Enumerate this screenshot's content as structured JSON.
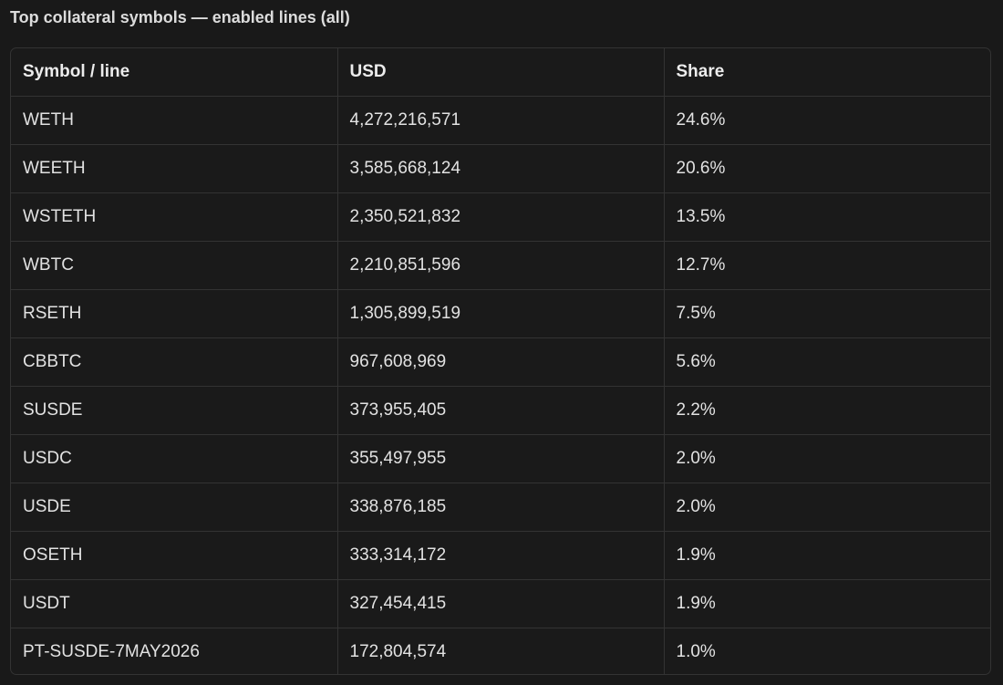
{
  "heading": "Top collateral symbols — enabled lines (all)",
  "table": {
    "columns": [
      "Symbol / line",
      "USD",
      "Share"
    ],
    "rows": [
      [
        "WETH",
        "4,272,216,571",
        "24.6%"
      ],
      [
        "WEETH",
        "3,585,668,124",
        "20.6%"
      ],
      [
        "WSTETH",
        "2,350,521,832",
        "13.5%"
      ],
      [
        "WBTC",
        "2,210,851,596",
        "12.7%"
      ],
      [
        "RSETH",
        "1,305,899,519",
        "7.5%"
      ],
      [
        "CBBTC",
        "967,608,969",
        "5.6%"
      ],
      [
        "SUSDE",
        "373,955,405",
        "2.2%"
      ],
      [
        "USDC",
        "355,497,955",
        "2.0%"
      ],
      [
        "USDE",
        "338,876,185",
        "2.0%"
      ],
      [
        "OSETH",
        "333,314,172",
        "1.9%"
      ],
      [
        "USDT",
        "327,454,415",
        "1.9%"
      ],
      [
        "PT-SUSDE-7MAY2026",
        "172,804,574",
        "1.0%"
      ]
    ]
  }
}
